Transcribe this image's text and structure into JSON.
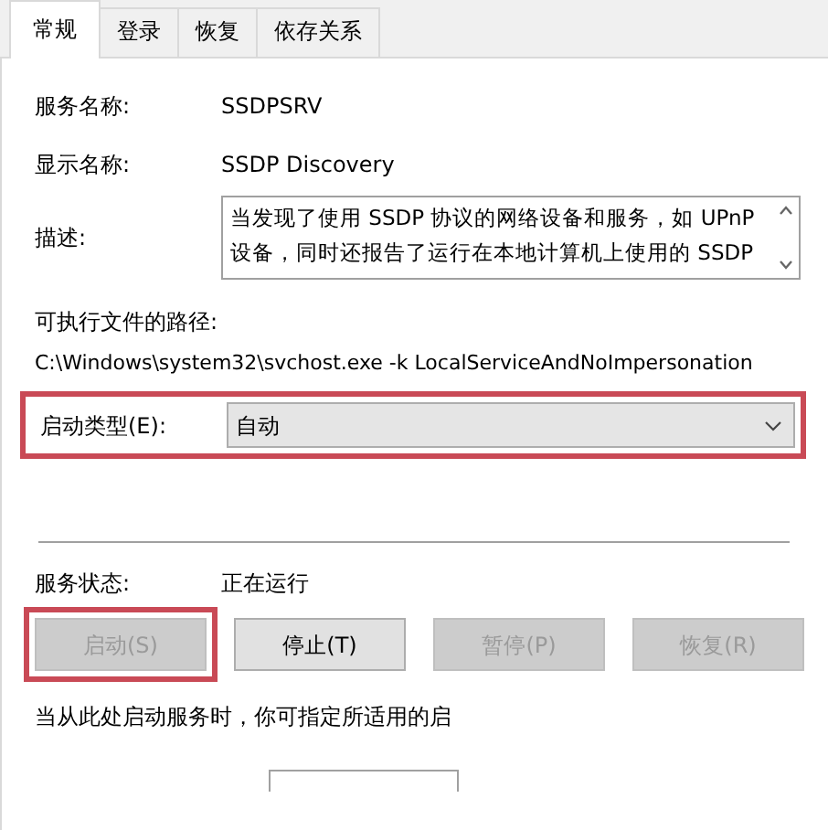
{
  "tabs": [
    {
      "label": "常规",
      "selected": true
    },
    {
      "label": "登录",
      "selected": false
    },
    {
      "label": "恢复",
      "selected": false
    },
    {
      "label": "依存关系",
      "selected": false
    }
  ],
  "service_name": {
    "label": "服务名称:",
    "value": "SSDPSRV"
  },
  "display_name": {
    "label": "显示名称:",
    "value": "SSDP Discovery"
  },
  "description": {
    "label": "描述:",
    "value": "当发现了使用 SSDP 协议的网络设备和服务，如 UPnP 设备，同时还报告了运行在本地计算机上使用的 SSDP"
  },
  "executable_path": {
    "label": "可执行文件的路径:",
    "value": "C:\\Windows\\system32\\svchost.exe -k LocalServiceAndNoImpersonation"
  },
  "startup_type": {
    "label": "启动类型(E):",
    "value": "自动",
    "highlighted": true
  },
  "service_status": {
    "label": "服务状态:",
    "value": "正在运行"
  },
  "buttons": [
    {
      "label": "启动(S)",
      "disabled": true,
      "highlighted": true
    },
    {
      "label": "停止(T)",
      "disabled": false,
      "highlighted": false
    },
    {
      "label": "暂停(P)",
      "disabled": true,
      "highlighted": false
    },
    {
      "label": "恢复(R)",
      "disabled": true,
      "highlighted": false
    }
  ],
  "hint": "当从此处启动服务时，你可指定所适用的启"
}
